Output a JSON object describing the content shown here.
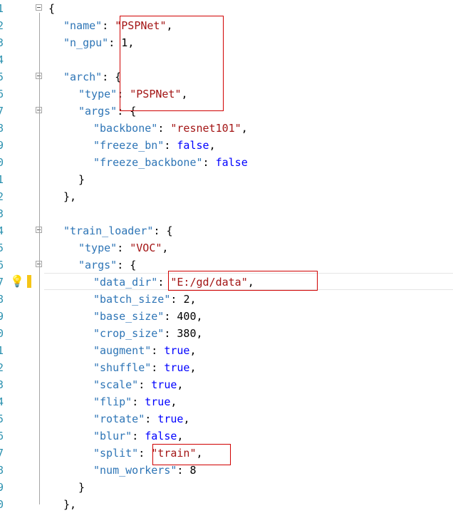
{
  "editor": {
    "line_numbers": [
      "1",
      "2",
      "3",
      "4",
      "5",
      "6",
      "7",
      "8",
      "9",
      "0",
      "1",
      "2",
      "3",
      "4",
      "5",
      "6",
      "7",
      "8",
      "9",
      "0",
      "1",
      "2",
      "3",
      "4",
      "5",
      "6",
      "7",
      "8",
      "9",
      "0"
    ],
    "lines": [
      {
        "text": "{"
      },
      {
        "key": "\"name\"",
        "value": "\"PSPNet\"",
        "tail": ","
      },
      {
        "key": "\"n_gpu\"",
        "value": "1",
        "tail": ","
      },
      {
        "text": ""
      },
      {
        "key": "\"arch\"",
        "tail": ": {"
      },
      {
        "key": "\"type\"",
        "value": "\"PSPNet\"",
        "tail": ","
      },
      {
        "key": "\"args\"",
        "tail": ": {"
      },
      {
        "key": "\"backbone\"",
        "value": "\"resnet101\"",
        "tail": ","
      },
      {
        "key": "\"freeze_bn\"",
        "value": "false",
        "tail": ","
      },
      {
        "key": "\"freeze_backbone\"",
        "value": "false",
        "tail": ""
      },
      {
        "text": "}"
      },
      {
        "text": "},"
      },
      {
        "text": ""
      },
      {
        "key": "\"train_loader\"",
        "tail": ": {"
      },
      {
        "key": "\"type\"",
        "value": "\"VOC\"",
        "tail": ","
      },
      {
        "key": "\"args\"",
        "tail": ": {"
      },
      {
        "key": "\"data_dir\"",
        "value": "\"E:/gd/data\"",
        "tail": ","
      },
      {
        "key": "\"batch_size\"",
        "value": "2",
        "tail": ","
      },
      {
        "key": "\"base_size\"",
        "value": "400",
        "tail": ","
      },
      {
        "key": "\"crop_size\"",
        "value": "380",
        "tail": ","
      },
      {
        "key": "\"augment\"",
        "value": "true",
        "tail": ","
      },
      {
        "key": "\"shuffle\"",
        "value": "true",
        "tail": ","
      },
      {
        "key": "\"scale\"",
        "value": "true",
        "tail": ","
      },
      {
        "key": "\"flip\"",
        "value": "true",
        "tail": ","
      },
      {
        "key": "\"rotate\"",
        "value": "true",
        "tail": ","
      },
      {
        "key": "\"blur\"",
        "value": "false",
        "tail": ","
      },
      {
        "key": "\"split\"",
        "value": "\"train\"",
        "tail": ","
      },
      {
        "key": "\"num_workers\"",
        "value": "8",
        "tail": ""
      },
      {
        "text": "}"
      },
      {
        "text": "},"
      }
    ]
  },
  "colors": {
    "key": "#2e75b6",
    "string": "#a31515",
    "bool": "#0000ff",
    "highlight_box": "#d00000",
    "line_number": "#2b91af"
  }
}
